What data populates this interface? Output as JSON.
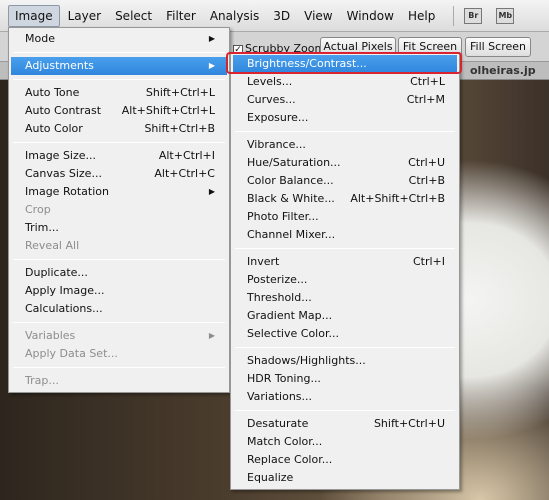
{
  "menubar": {
    "items": [
      "Image",
      "Layer",
      "Select",
      "Filter",
      "Analysis",
      "3D",
      "View",
      "Window",
      "Help"
    ],
    "active": "Image",
    "icons": [
      "Br",
      "Mb"
    ]
  },
  "options": {
    "scrubby_zoom": "Scrubby Zoom",
    "scrubby_checked": true,
    "actual_pixels": "Actual Pixels",
    "fit_screen": "Fit Screen",
    "fill_screen": "Fill Screen"
  },
  "document_tab": "olheiras.jp",
  "image_menu": [
    {
      "label": "Mode",
      "submenu": true
    },
    {
      "sep": true
    },
    {
      "label": "Adjustments",
      "submenu": true,
      "highlighted": true
    },
    {
      "sep": true
    },
    {
      "label": "Auto Tone",
      "shortcut": "Shift+Ctrl+L"
    },
    {
      "label": "Auto Contrast",
      "shortcut": "Alt+Shift+Ctrl+L"
    },
    {
      "label": "Auto Color",
      "shortcut": "Shift+Ctrl+B"
    },
    {
      "sep": true
    },
    {
      "label": "Image Size...",
      "shortcut": "Alt+Ctrl+I"
    },
    {
      "label": "Canvas Size...",
      "shortcut": "Alt+Ctrl+C"
    },
    {
      "label": "Image Rotation",
      "submenu": true
    },
    {
      "label": "Crop",
      "disabled": true
    },
    {
      "label": "Trim..."
    },
    {
      "label": "Reveal All",
      "disabled": true
    },
    {
      "sep": true
    },
    {
      "label": "Duplicate..."
    },
    {
      "label": "Apply Image..."
    },
    {
      "label": "Calculations..."
    },
    {
      "sep": true
    },
    {
      "label": "Variables",
      "submenu": true,
      "disabled": true
    },
    {
      "label": "Apply Data Set...",
      "disabled": true
    },
    {
      "sep": true
    },
    {
      "label": "Trap...",
      "disabled": true
    }
  ],
  "adjustments_menu": [
    {
      "label": "Brightness/Contrast...",
      "highlighted": true
    },
    {
      "label": "Levels...",
      "shortcut": "Ctrl+L"
    },
    {
      "label": "Curves...",
      "shortcut": "Ctrl+M"
    },
    {
      "label": "Exposure..."
    },
    {
      "sep": true
    },
    {
      "label": "Vibrance..."
    },
    {
      "label": "Hue/Saturation...",
      "shortcut": "Ctrl+U"
    },
    {
      "label": "Color Balance...",
      "shortcut": "Ctrl+B"
    },
    {
      "label": "Black & White...",
      "shortcut": "Alt+Shift+Ctrl+B"
    },
    {
      "label": "Photo Filter..."
    },
    {
      "label": "Channel Mixer..."
    },
    {
      "sep": true
    },
    {
      "label": "Invert",
      "shortcut": "Ctrl+I"
    },
    {
      "label": "Posterize..."
    },
    {
      "label": "Threshold..."
    },
    {
      "label": "Gradient Map..."
    },
    {
      "label": "Selective Color..."
    },
    {
      "sep": true
    },
    {
      "label": "Shadows/Highlights..."
    },
    {
      "label": "HDR Toning..."
    },
    {
      "label": "Variations..."
    },
    {
      "sep": true
    },
    {
      "label": "Desaturate",
      "shortcut": "Shift+Ctrl+U"
    },
    {
      "label": "Match Color..."
    },
    {
      "label": "Replace Color..."
    },
    {
      "label": "Equalize"
    }
  ],
  "colors": {
    "highlight": "#3a8fe3",
    "callout": "#d9232f"
  }
}
